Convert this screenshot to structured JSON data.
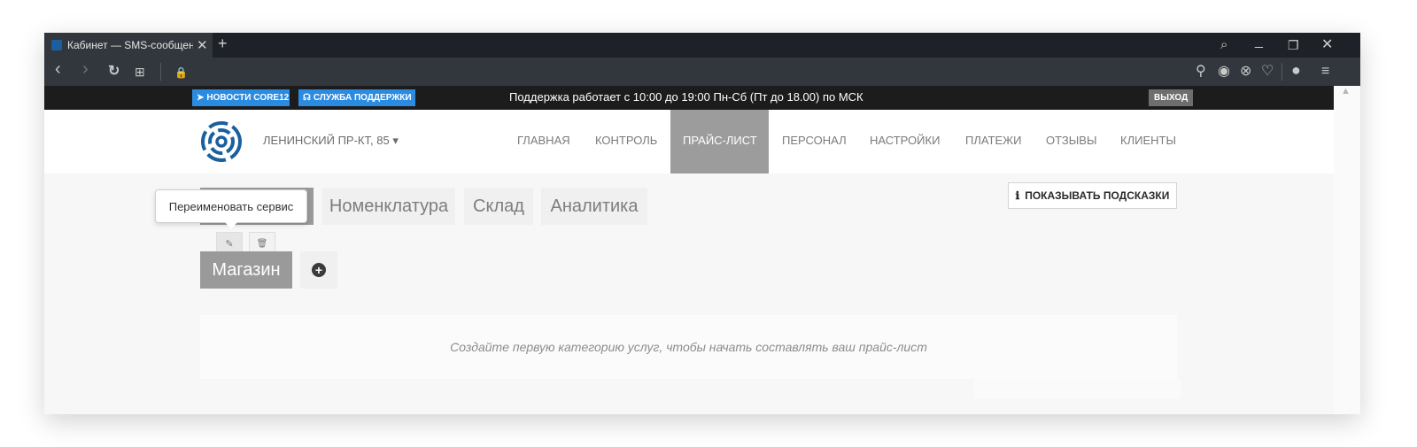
{
  "browser": {
    "tab_title": "Кабинет — SMS-сообщения",
    "tab_close_glyph": "✕",
    "new_tab_glyph": "+",
    "window_controls": {
      "search": "⌕",
      "minimize": "_",
      "restore": "❐",
      "close": "✕"
    },
    "toolbar": {
      "back": "‹",
      "forward": "›",
      "reload": "↻",
      "speed_dial": "⊞",
      "lock": "🔒",
      "search_page": "⚲",
      "screenshot": "◉",
      "close_circle": "⊗",
      "favorite": "♡",
      "profile": "●",
      "settings": "≡"
    }
  },
  "topbar": {
    "news_label": "НОВОСТИ CORE12",
    "support_label": "СЛУЖБА ПОДДЕРЖКИ",
    "support_hours": "Поддержка работает с 10:00 до 19:00 Пн-Сб (Пт до 18.00) по МСК",
    "logout_label": "ВЫХОД"
  },
  "nav": {
    "location": "ЛЕНИНСКИЙ ПР-КТ, 85",
    "location_caret": "▾",
    "items": [
      "ГЛАВНАЯ",
      "КОНТРОЛЬ",
      "ПРАЙС-ЛИСТ",
      "ПЕРСОНАЛ",
      "НАСТРОЙКИ",
      "ПЛАТЕЖИ",
      "ОТЗЫВЫ",
      "КЛИЕНТЫ"
    ],
    "active_item": "ПРАЙС-ЛИСТ"
  },
  "content": {
    "subtabs": [
      "Номенклатура",
      "Склад",
      "Аналитика"
    ],
    "hints_icon": "ℹ",
    "hints_label": "ПОКАЗЫВАТЬ ПОДСКАЗКИ",
    "edit_glyph": "✎",
    "delete_glyph": "🗑",
    "service_name": "Магазин",
    "add_glyph": "+",
    "tooltip": "Переименовать сервис",
    "empty_message": "Создайте первую категорию услуг, чтобы начать составлять ваш прайс-лист"
  },
  "colors": {
    "accent_blue": "#2b8be0",
    "logo_blue": "#1c5f9e",
    "active_nav_bg": "#9c9c9c",
    "topbar_bg": "#1c1c1c"
  }
}
